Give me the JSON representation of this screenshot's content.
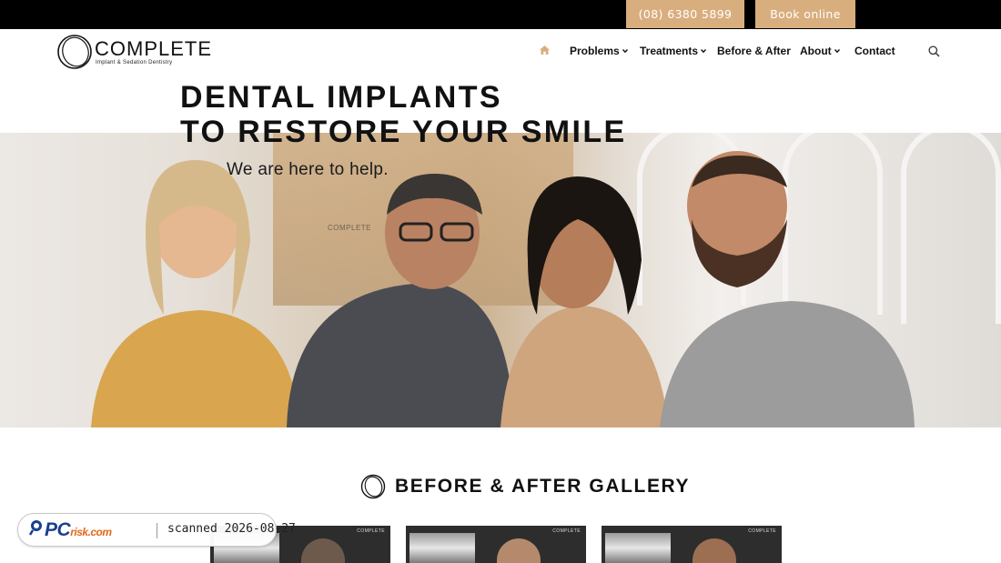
{
  "topbar": {
    "phone_label": "(08) 6380 5899",
    "book_label": "Book online",
    "accent_color": "#d9ae7e"
  },
  "brand": {
    "name": "COMPLETE",
    "tagline": "Implant & Sedation Dentistry"
  },
  "nav": {
    "home_icon": "home-icon",
    "items": [
      {
        "label": "Problems",
        "dropdown": true
      },
      {
        "label": "Treatments",
        "dropdown": true
      },
      {
        "label": "Before & After",
        "dropdown": false
      },
      {
        "label": "About",
        "dropdown": true
      },
      {
        "label": "Contact",
        "dropdown": false
      }
    ],
    "search_icon": "search-icon"
  },
  "hero": {
    "title_line1": "DENTAL IMPLANTS",
    "title_line2": "TO RESTORE YOUR SMILE",
    "subtitle": "We are here to help."
  },
  "gallery": {
    "title": "BEFORE & AFTER GALLERY",
    "thumbnails": [
      {
        "watermark": "COMPLETE"
      },
      {
        "watermark": "COMPLETE"
      },
      {
        "watermark": "COMPLETE"
      }
    ]
  },
  "scan_badge": {
    "logo_main": "PC",
    "logo_suffix": "risk.com",
    "text": "scanned 2026-08-27"
  }
}
